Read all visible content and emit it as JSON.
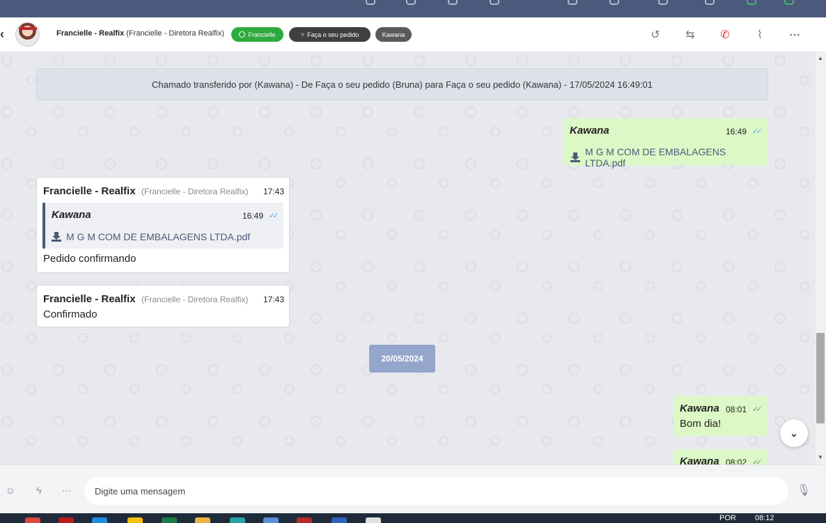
{
  "header": {
    "contact_name": "Francielle - Realfix",
    "contact_role": "(Francielle - Diretora Realfix)",
    "tags": [
      "Francielle",
      "Faça o seu pedido",
      "Kawana"
    ]
  },
  "system_message": "Chamado transferido por (Kawana) - De Faça o seu pedido (Bruna) para Faça o seu pedido (Kawana) - 17/05/2024 16:49:01",
  "messages": {
    "out1": {
      "sender": "Kawana",
      "time": "16:49",
      "file": "M G M COM DE EMBALAGENS LTDA.pdf"
    },
    "in1": {
      "sender": "Francielle - Realfix",
      "role": "(Francielle - Diretora Realfix)",
      "time": "17:43",
      "quote": {
        "sender": "Kawana",
        "time": "16:49",
        "file": "M G M COM DE EMBALAGENS LTDA.pdf"
      },
      "text": "Pedido confirmando"
    },
    "in2": {
      "sender": "Francielle - Realfix",
      "role": "(Francielle - Diretora Realfix)",
      "time": "17:43",
      "text": "Confirmado"
    },
    "date_divider": "20/05/2024",
    "out2": {
      "sender": "Kawana",
      "time": "08:01",
      "text": "Bom dia!"
    },
    "out3": {
      "sender": "Kawana",
      "time": "08:02"
    }
  },
  "composer": {
    "placeholder": "Digite uma mensagem"
  },
  "taskbar": {
    "lang": "POR",
    "clock": "08:12"
  },
  "colors": {
    "outgoing": "#dcf8c6",
    "whatsapp_tag": "#2eaa3e",
    "date_chip": "#95a6cc",
    "read_ticks": "#4fb0e8"
  }
}
